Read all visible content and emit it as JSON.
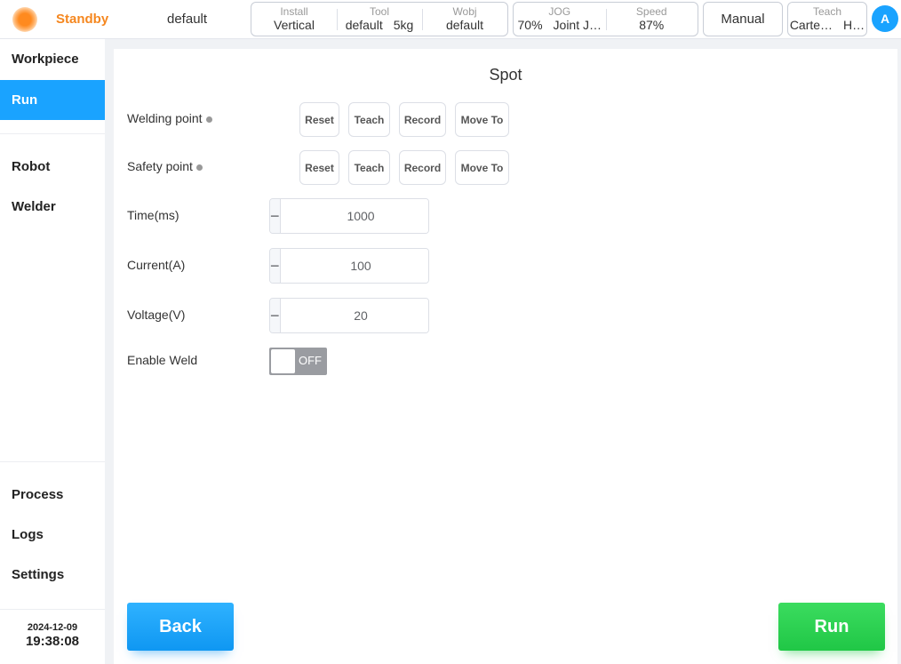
{
  "topbar": {
    "status": "Standby",
    "program": "default",
    "install": {
      "label": "Install",
      "value": "Vertical"
    },
    "tool": {
      "label": "Tool",
      "name": "default",
      "payload": "5kg"
    },
    "wobj": {
      "label": "Wobj",
      "value": "default"
    },
    "jog": {
      "label": "JOG",
      "percent": "70%",
      "mode": "Joint J…"
    },
    "speed": {
      "label": "Speed",
      "value": "87%"
    },
    "mode": "Manual",
    "teach": {
      "label": "Teach",
      "frame": "Carte…",
      "extra": "H…"
    },
    "avatar": "A",
    "colors": {
      "status": "#f5871f",
      "accent": "#1aa3ff"
    }
  },
  "sidebar": {
    "top_items": [
      "Workpiece",
      "Run"
    ],
    "mid_items": [
      "Robot",
      "Welder"
    ],
    "bottom_items": [
      "Process",
      "Logs",
      "Settings"
    ],
    "active": "Run",
    "date": "2024-12-09",
    "time": "19:38:08"
  },
  "main": {
    "title": "Spot",
    "welding_point": {
      "label": "Welding point",
      "buttons": [
        "Reset",
        "Teach",
        "Record",
        "Move To"
      ]
    },
    "safety_point": {
      "label": "Safety point",
      "buttons": [
        "Reset",
        "Teach",
        "Record",
        "Move To"
      ]
    },
    "time": {
      "label": "Time(ms)",
      "value": "1000"
    },
    "current": {
      "label": "Current(A)",
      "value": "100"
    },
    "voltage": {
      "label": "Voltage(V)",
      "value": "20"
    },
    "enable_weld": {
      "label": "Enable Weld",
      "state": "OFF"
    },
    "stepper_minus": "−",
    "stepper_plus": "+",
    "back": "Back",
    "run": "Run"
  }
}
